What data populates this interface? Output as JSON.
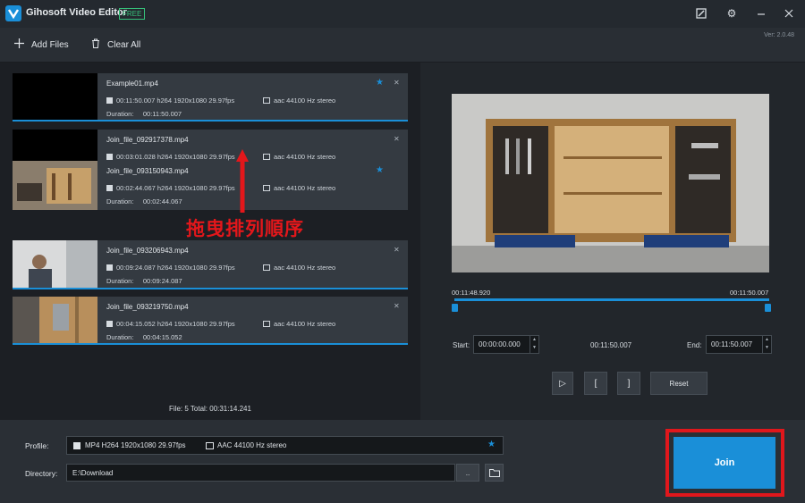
{
  "app": {
    "title": "Gihosoft Video Editor",
    "badge": "FREE",
    "version": "Ver: 2.0.48"
  },
  "window_icons": [
    "edit-icon",
    "gear-icon",
    "minimize-icon",
    "close-icon"
  ],
  "toolbar": {
    "add_files": "Add Files",
    "clear_all": "Clear All"
  },
  "clips": [
    {
      "name": "Example01.mp4",
      "video": "00:11:50.007 h264 1920x1080 29.97fps",
      "audio": "aac 44100 Hz stereo",
      "duration_label": "Duration:",
      "duration": "00:11:50.007",
      "starred": true
    },
    {
      "name": "Join_file_092917378.mp4",
      "video": "00:03:01.028 h264 1920x1080 29.97fps",
      "audio": "aac 44100 Hz stereo",
      "starred": false
    },
    {
      "name": "Join_file_093150943.mp4",
      "video": "00:02:44.067 h264 1920x1080 29.97fps",
      "audio": "aac 44100 Hz stereo",
      "duration_label": "Duration:",
      "duration": "00:02:44.067",
      "starred": true
    },
    {
      "name": "Join_file_093206943.mp4",
      "video": "00:09:24.087 h264 1920x1080 29.97fps",
      "audio": "aac 44100 Hz stereo",
      "duration_label": "Duration:",
      "duration": "00:09:24.087",
      "starred": false
    },
    {
      "name": "Join_file_093219750.mp4",
      "video": "00:04:15.052 h264 1920x1080 29.97fps",
      "audio": "aac 44100 Hz stereo",
      "duration_label": "Duration:",
      "duration": "00:04:15.052",
      "starred": false
    }
  ],
  "annotation": "拖曳排列順序",
  "summary": "File: 5   Total: 00:31:14.241",
  "timeline": {
    "left_time": "00:11:48.920",
    "right_time": "00:11:50.007"
  },
  "trim": {
    "start_label": "Start:",
    "start_value": "00:00:00.000",
    "duration_value": "00:11:50.007",
    "end_label": "End:",
    "end_value": "00:11:50.007"
  },
  "controls": {
    "play": "▷",
    "mark_in": "[",
    "mark_out": "]",
    "reset": "Reset"
  },
  "output": {
    "profile_label": "Profile:",
    "profile_video": "MP4 H264 1920x1080 29.97fps",
    "profile_audio": "AAC 44100 Hz stereo",
    "directory_label": "Directory:",
    "directory_value": "E:\\Download",
    "browse": ".."
  },
  "join_label": "Join",
  "colors": {
    "accent": "#1a8fd8",
    "highlight": "#e0171c",
    "free": "#36c07a"
  }
}
